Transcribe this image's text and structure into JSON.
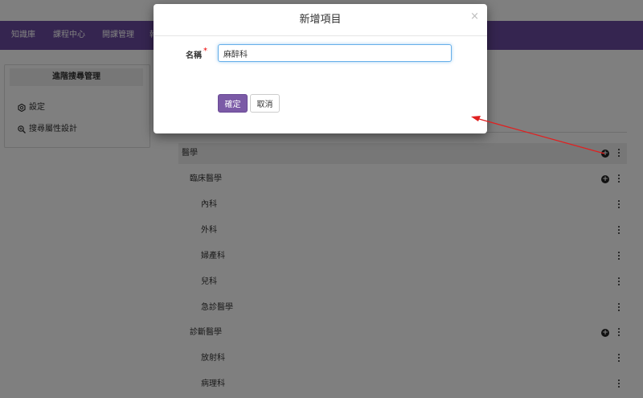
{
  "nav": {
    "items": [
      "知識庫",
      "課程中心",
      "開課管理",
      "報"
    ]
  },
  "sidebar": {
    "title": "進階搜尋管理",
    "items": [
      {
        "label": "設定",
        "icon": "gear-icon"
      },
      {
        "label": "搜尋屬性設計",
        "icon": "zoom-in-icon"
      }
    ]
  },
  "tree": {
    "rows": [
      {
        "label": "醫學",
        "level": 0,
        "has_add": true
      },
      {
        "label": "臨床醫學",
        "level": 1,
        "has_add": true
      },
      {
        "label": "內科",
        "level": 2,
        "has_add": false
      },
      {
        "label": "外科",
        "level": 2,
        "has_add": false
      },
      {
        "label": "婦產科",
        "level": 2,
        "has_add": false
      },
      {
        "label": "兒科",
        "level": 2,
        "has_add": false
      },
      {
        "label": "急診醫學",
        "level": 2,
        "has_add": false
      },
      {
        "label": "診斷醫學",
        "level": 1,
        "has_add": true
      },
      {
        "label": "放射科",
        "level": 2,
        "has_add": false
      },
      {
        "label": "病理科",
        "level": 2,
        "has_add": false
      }
    ]
  },
  "modal": {
    "title": "新增項目",
    "close": "×",
    "name_label": "名稱",
    "required_mark": "*",
    "name_value": "麻醉科",
    "ok_label": "確定",
    "cancel_label": "取消"
  },
  "colors": {
    "brand": "#6a4aa0",
    "primary_button": "#7b5aa6",
    "annotation_arrow": "#e02020"
  }
}
